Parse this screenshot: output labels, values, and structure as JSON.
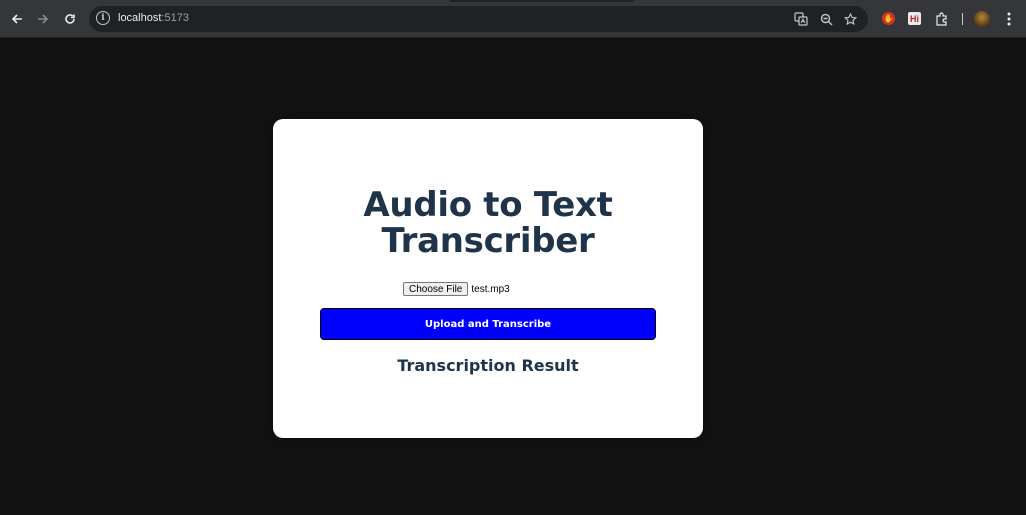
{
  "browser": {
    "url_host": "localhost",
    "url_port": ":5173",
    "icons": {
      "back": "back-arrow-icon",
      "forward": "forward-arrow-icon",
      "reload": "reload-icon",
      "info": "site-info-icon",
      "translate": "translate-icon",
      "zoom": "zoom-icon",
      "bookmark": "star-icon",
      "menu": "more-vert-icon"
    },
    "extensions": {
      "hi_label": "Hi"
    }
  },
  "app": {
    "title": "Audio to Text Transcriber",
    "file_input": {
      "button_label": "Choose File",
      "selected_file": "test.mp3"
    },
    "upload_button_label": "Upload and Transcribe",
    "result_heading": "Transcription Result",
    "colors": {
      "accent": "#0000ff",
      "heading": "#1f3349",
      "page_bg": "#121212",
      "card_bg": "#ffffff"
    }
  }
}
